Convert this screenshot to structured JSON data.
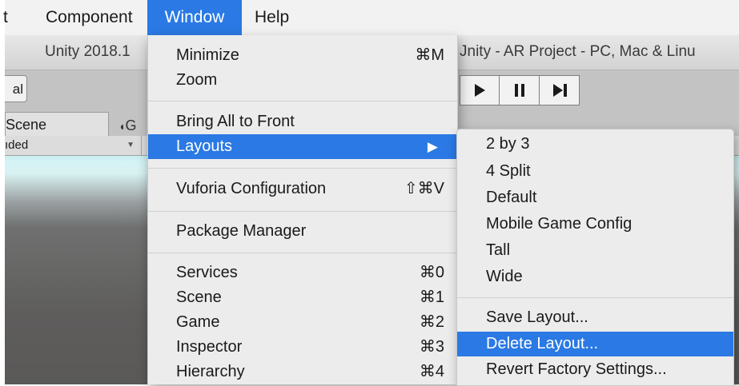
{
  "menubar": {
    "items": [
      {
        "label": "t"
      },
      {
        "label": "Component"
      },
      {
        "label": "Window"
      },
      {
        "label": "Help"
      }
    ]
  },
  "window": {
    "title_left": "Unity 2018.1",
    "title_right": "Jnity - AR Project - PC, Mac & Linu",
    "global_button": "al",
    "scene_tab": "Scene",
    "game_tab": "G",
    "shading_mode": "ıded"
  },
  "window_menu": {
    "items": [
      {
        "label": "Minimize",
        "shortcut": "⌘M"
      },
      {
        "label": "Zoom",
        "shortcut": ""
      },
      {
        "label": "Bring All to Front",
        "shortcut": ""
      },
      {
        "label": "Layouts",
        "shortcut": "▶"
      },
      {
        "label": "Vuforia Configuration",
        "shortcut": "⇧⌘V"
      },
      {
        "label": "Package Manager",
        "shortcut": ""
      },
      {
        "label": "Services",
        "shortcut": "⌘0"
      },
      {
        "label": "Scene",
        "shortcut": "⌘1"
      },
      {
        "label": "Game",
        "shortcut": "⌘2"
      },
      {
        "label": "Inspector",
        "shortcut": "⌘3"
      },
      {
        "label": "Hierarchy",
        "shortcut": "⌘4"
      }
    ]
  },
  "layouts_menu": {
    "items": [
      {
        "label": "2 by 3"
      },
      {
        "label": "4 Split"
      },
      {
        "label": "Default"
      },
      {
        "label": "Mobile Game Config"
      },
      {
        "label": "Tall"
      },
      {
        "label": "Wide"
      },
      {
        "label": "Save Layout..."
      },
      {
        "label": "Delete Layout..."
      },
      {
        "label": "Revert Factory Settings..."
      }
    ]
  },
  "colors": {
    "highlight": "#2a79e4",
    "menu_bg": "#ececec",
    "menubar_bg": "#f2f2f2"
  },
  "icons": {
    "play": "play-icon",
    "pause": "pause-icon",
    "step": "step-icon",
    "submenu": "chevron-right-icon",
    "game_tab": "game-controller-icon"
  }
}
